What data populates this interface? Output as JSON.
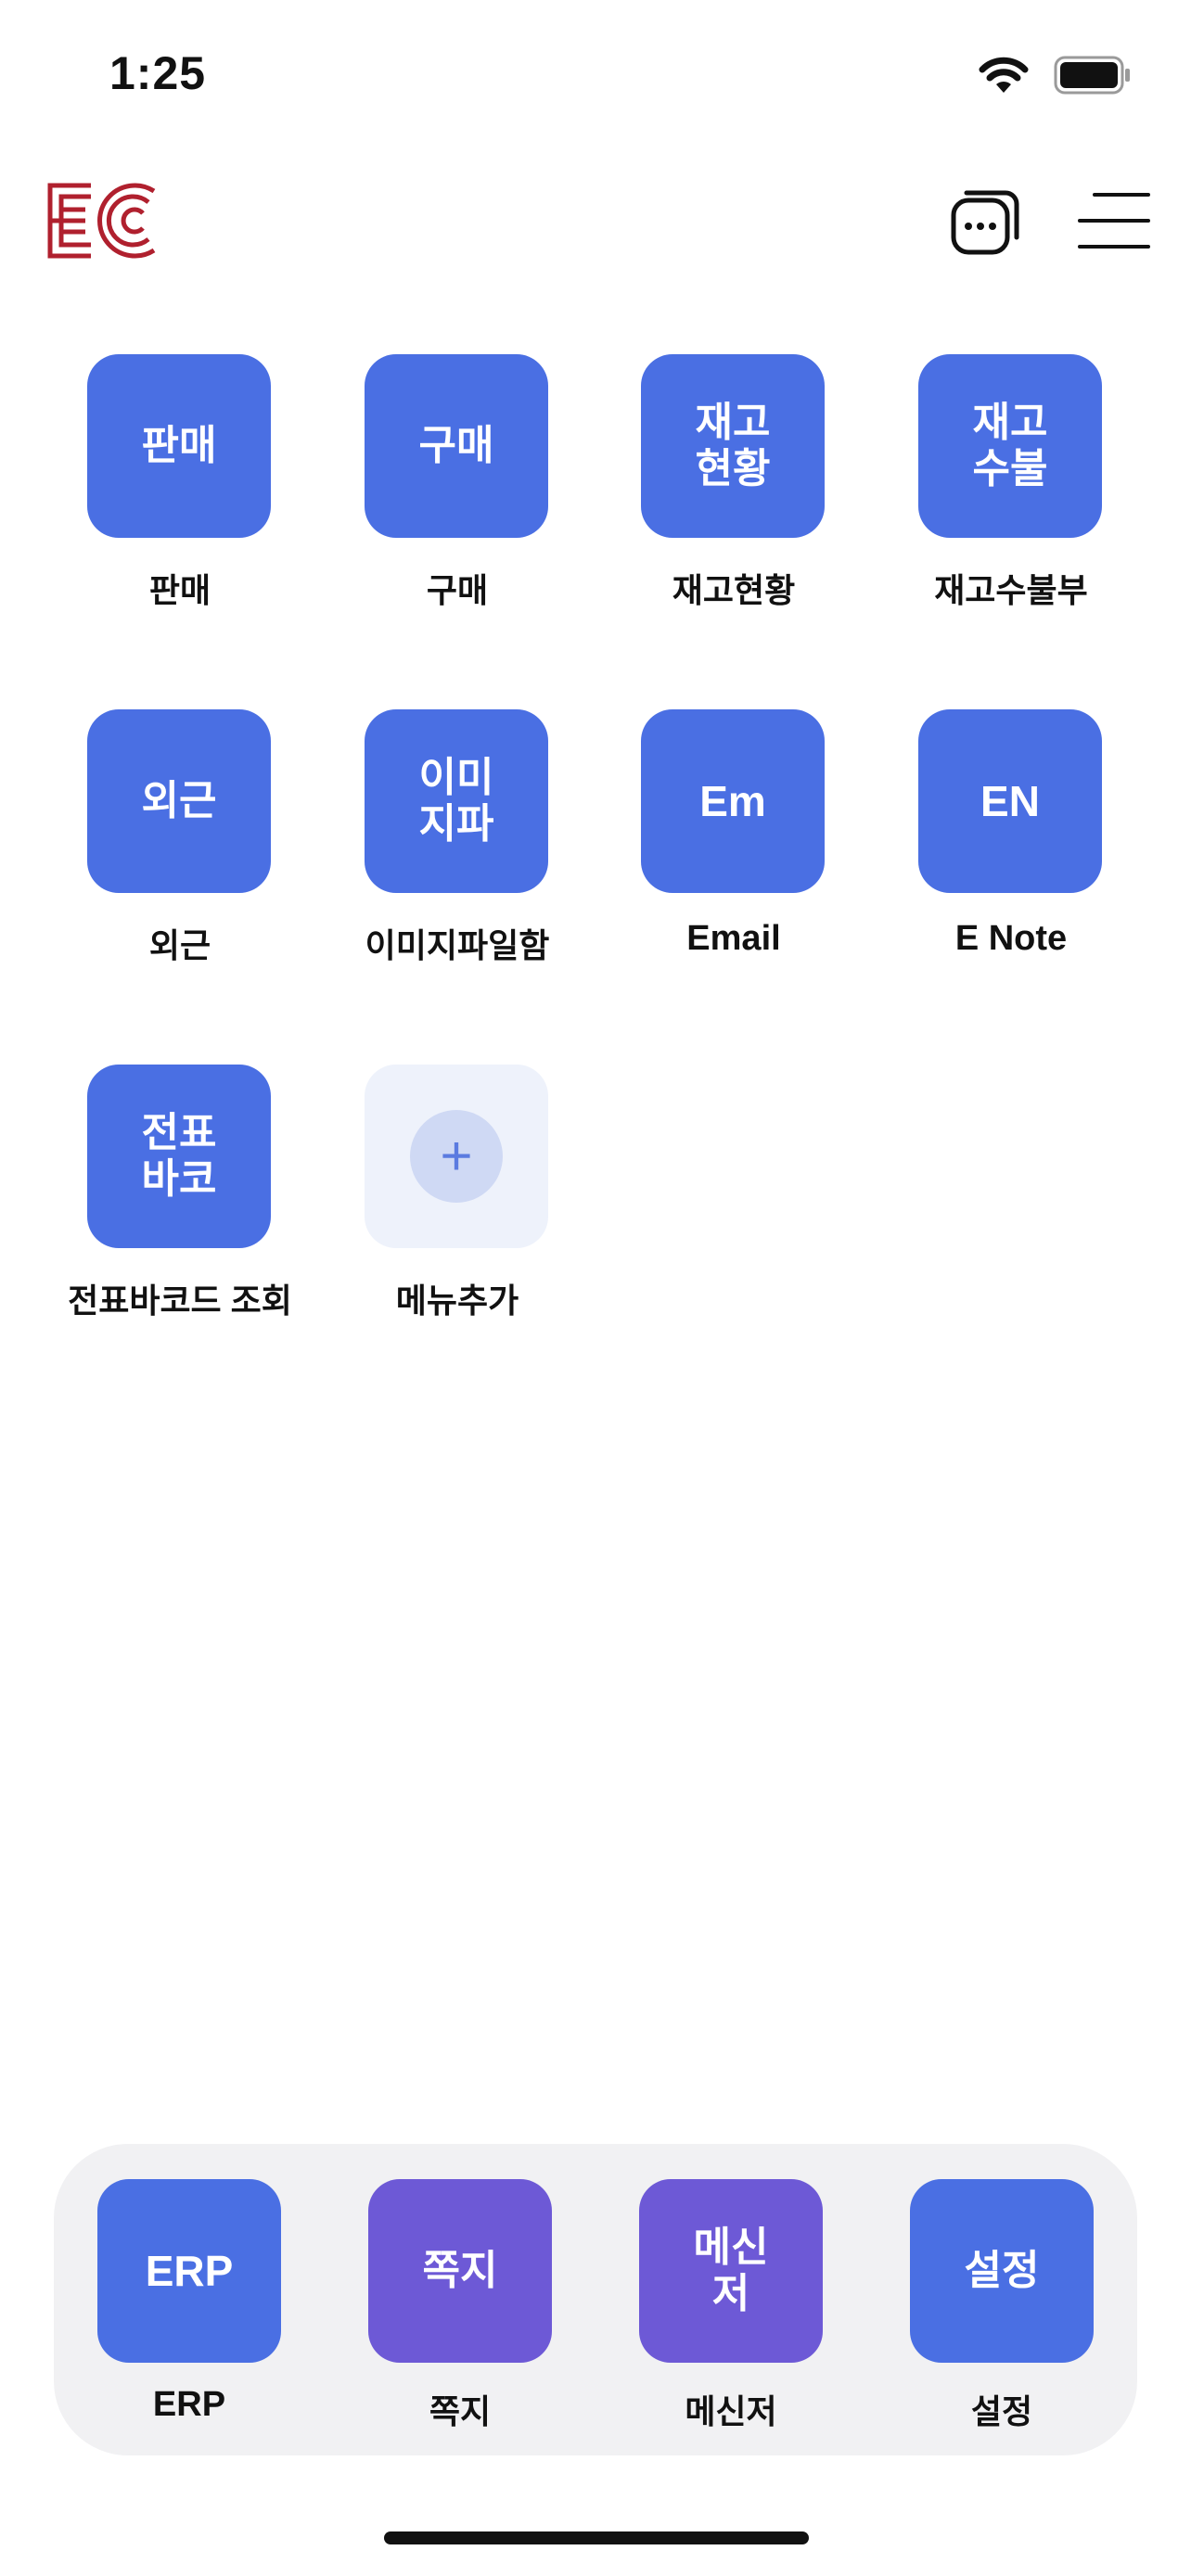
{
  "status_bar": {
    "time": "1:25",
    "icons": [
      "wifi-icon",
      "battery-icon"
    ]
  },
  "header": {
    "logo": "EC",
    "icons": [
      "chat-bubbles-icon",
      "hamburger-menu-icon"
    ]
  },
  "accent_colors": {
    "tile_blue": "#4a6fe3",
    "tile_purple": "#6d59d6",
    "logo_red": "#b0202e",
    "add_tile_bg": "#eef2fb"
  },
  "menu": {
    "items": [
      {
        "icon_text": "판매",
        "label": "판매"
      },
      {
        "icon_text": "구매",
        "label": "구매"
      },
      {
        "icon_text": "재고\n현황",
        "label": "재고현황"
      },
      {
        "icon_text": "재고\n수불",
        "label": "재고수불부"
      },
      {
        "icon_text": "외근",
        "label": "외근"
      },
      {
        "icon_text": "이미\n지파",
        "label": "이미지파일함"
      },
      {
        "icon_text": "Em",
        "label": "Email"
      },
      {
        "icon_text": "EN",
        "label": "E Note"
      },
      {
        "icon_text": "전표\n바코",
        "label": "전표바코드 조회"
      }
    ],
    "add": {
      "icon_text": "+",
      "label": "메뉴추가"
    }
  },
  "dock": {
    "items": [
      {
        "icon_text": "ERP",
        "label": "ERP"
      },
      {
        "icon_text": "쪽지",
        "label": "쪽지"
      },
      {
        "icon_text": "메신\n저",
        "label": "메신저"
      },
      {
        "icon_text": "설정",
        "label": "설정"
      }
    ]
  }
}
